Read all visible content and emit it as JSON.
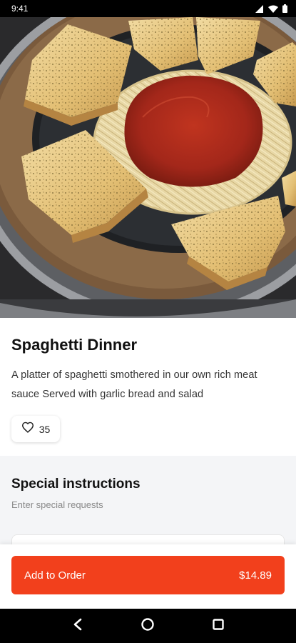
{
  "status_bar": {
    "time": "9:41",
    "icons": [
      "cellular-signal-icon",
      "wifi-icon",
      "battery-icon"
    ]
  },
  "hero": {
    "image": "spaghetti-dinner-photo"
  },
  "item": {
    "title": "Spaghetti Dinner",
    "description": "A platter of spaghetti smothered in our own rich meat sauce Served with garlic bread and salad",
    "likes": "35"
  },
  "special_instructions": {
    "title": "Special instructions",
    "subtitle": "Enter special requests",
    "value": ""
  },
  "footer": {
    "button_label": "Add to Order",
    "price": "$14.89"
  },
  "nav_bar": {
    "icons": [
      "back-icon",
      "home-icon",
      "recents-icon"
    ]
  },
  "colors": {
    "accent": "#f2401c",
    "section_bg": "#f4f5f7",
    "status_bar_bg": "#000000"
  }
}
